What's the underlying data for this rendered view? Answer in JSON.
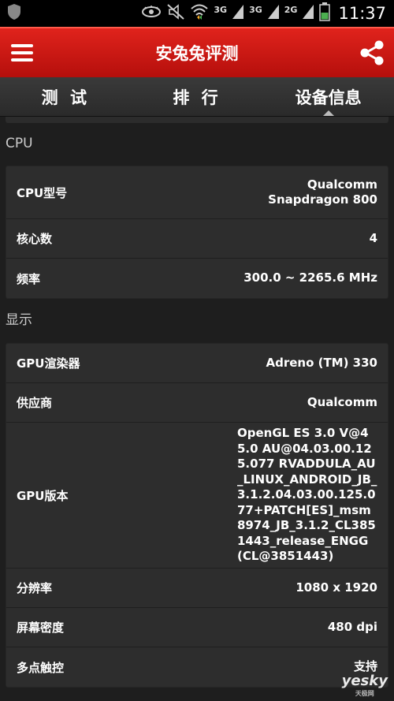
{
  "status_bar": {
    "network_1": "3G",
    "network_2": "3G",
    "network_3": "2G",
    "time": "11:37",
    "icons": [
      "shield-icon",
      "eye-icon",
      "silent-icon",
      "wifi-icon",
      "signal-icon",
      "battery-icon"
    ]
  },
  "app_bar": {
    "title": "安兔兔评测"
  },
  "tabs": [
    {
      "label": "测 试"
    },
    {
      "label": "排 行"
    },
    {
      "label": "设备信息",
      "active": true
    }
  ],
  "sections": {
    "cpu": {
      "title": "CPU",
      "rows": [
        {
          "label": "CPU型号",
          "value": "Qualcomm Snapdragon 800"
        },
        {
          "label": "核心数",
          "value": "4"
        },
        {
          "label": "频率",
          "value": "300.0 ~ 2265.6 MHz"
        }
      ]
    },
    "display": {
      "title": "显示",
      "rows": [
        {
          "label": "GPU渲染器",
          "value": "Adreno (TM) 330"
        },
        {
          "label": "供应商",
          "value": "Qualcomm"
        },
        {
          "label": "GPU版本",
          "value": "OpenGL ES 3.0 V@45.0 AU@04.03.00.125.077 RVADDULA_AU_LINUX_ANDROID_JB_3.1.2.04.03.00.125.077+PATCH[ES]_msm8974_JB_3.1.2_CL3851443_release_ENGG (CL@3851443)"
        },
        {
          "label": "分辨率",
          "value": "1080 x 1920"
        },
        {
          "label": "屏幕密度",
          "value": "480 dpi"
        },
        {
          "label": "多点触控",
          "value": "支持"
        }
      ]
    }
  },
  "watermark": {
    "text": "yesky",
    "sub": "天极网"
  },
  "colors": {
    "accent": "#d01a15",
    "background": "#1e1e1e",
    "card": "#2d2d2d"
  }
}
